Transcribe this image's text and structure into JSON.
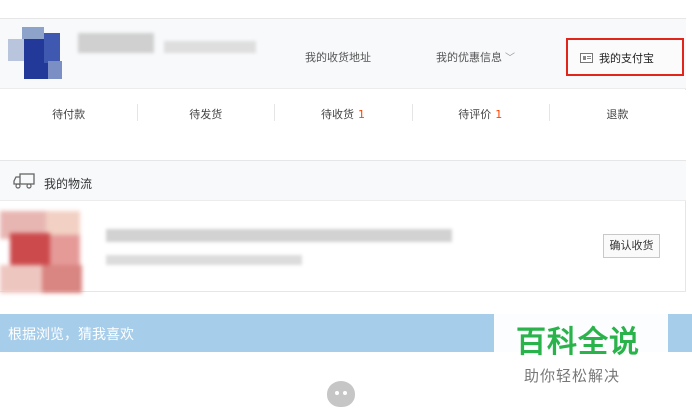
{
  "header": {
    "address_link": "我的收货地址",
    "coupon_link": "我的优惠信息",
    "alipay_link": "我的支付宝"
  },
  "order_tabs": [
    {
      "label": "待付款",
      "count": ""
    },
    {
      "label": "待发货",
      "count": ""
    },
    {
      "label": "待收货",
      "count": "1"
    },
    {
      "label": "待评价",
      "count": "1"
    },
    {
      "label": "退款",
      "count": ""
    }
  ],
  "logistics": {
    "title": "我的物流",
    "confirm_button": "确认收货"
  },
  "guess": {
    "title": "根据浏览，猜我喜欢"
  },
  "watermark": {
    "title": "百科全说",
    "subtitle": "助你轻松解决"
  },
  "colors": {
    "accent_red": "#e1251b",
    "badge_orange": "#ff4400",
    "banner_blue": "#a6cdea",
    "watermark_green": "#2ab34a"
  },
  "icons": {
    "alipay": "alipay-card-icon",
    "logistics": "truck-icon",
    "coupon_dropdown": "chevron-down-icon",
    "loading": "loading-mascot-icon"
  }
}
